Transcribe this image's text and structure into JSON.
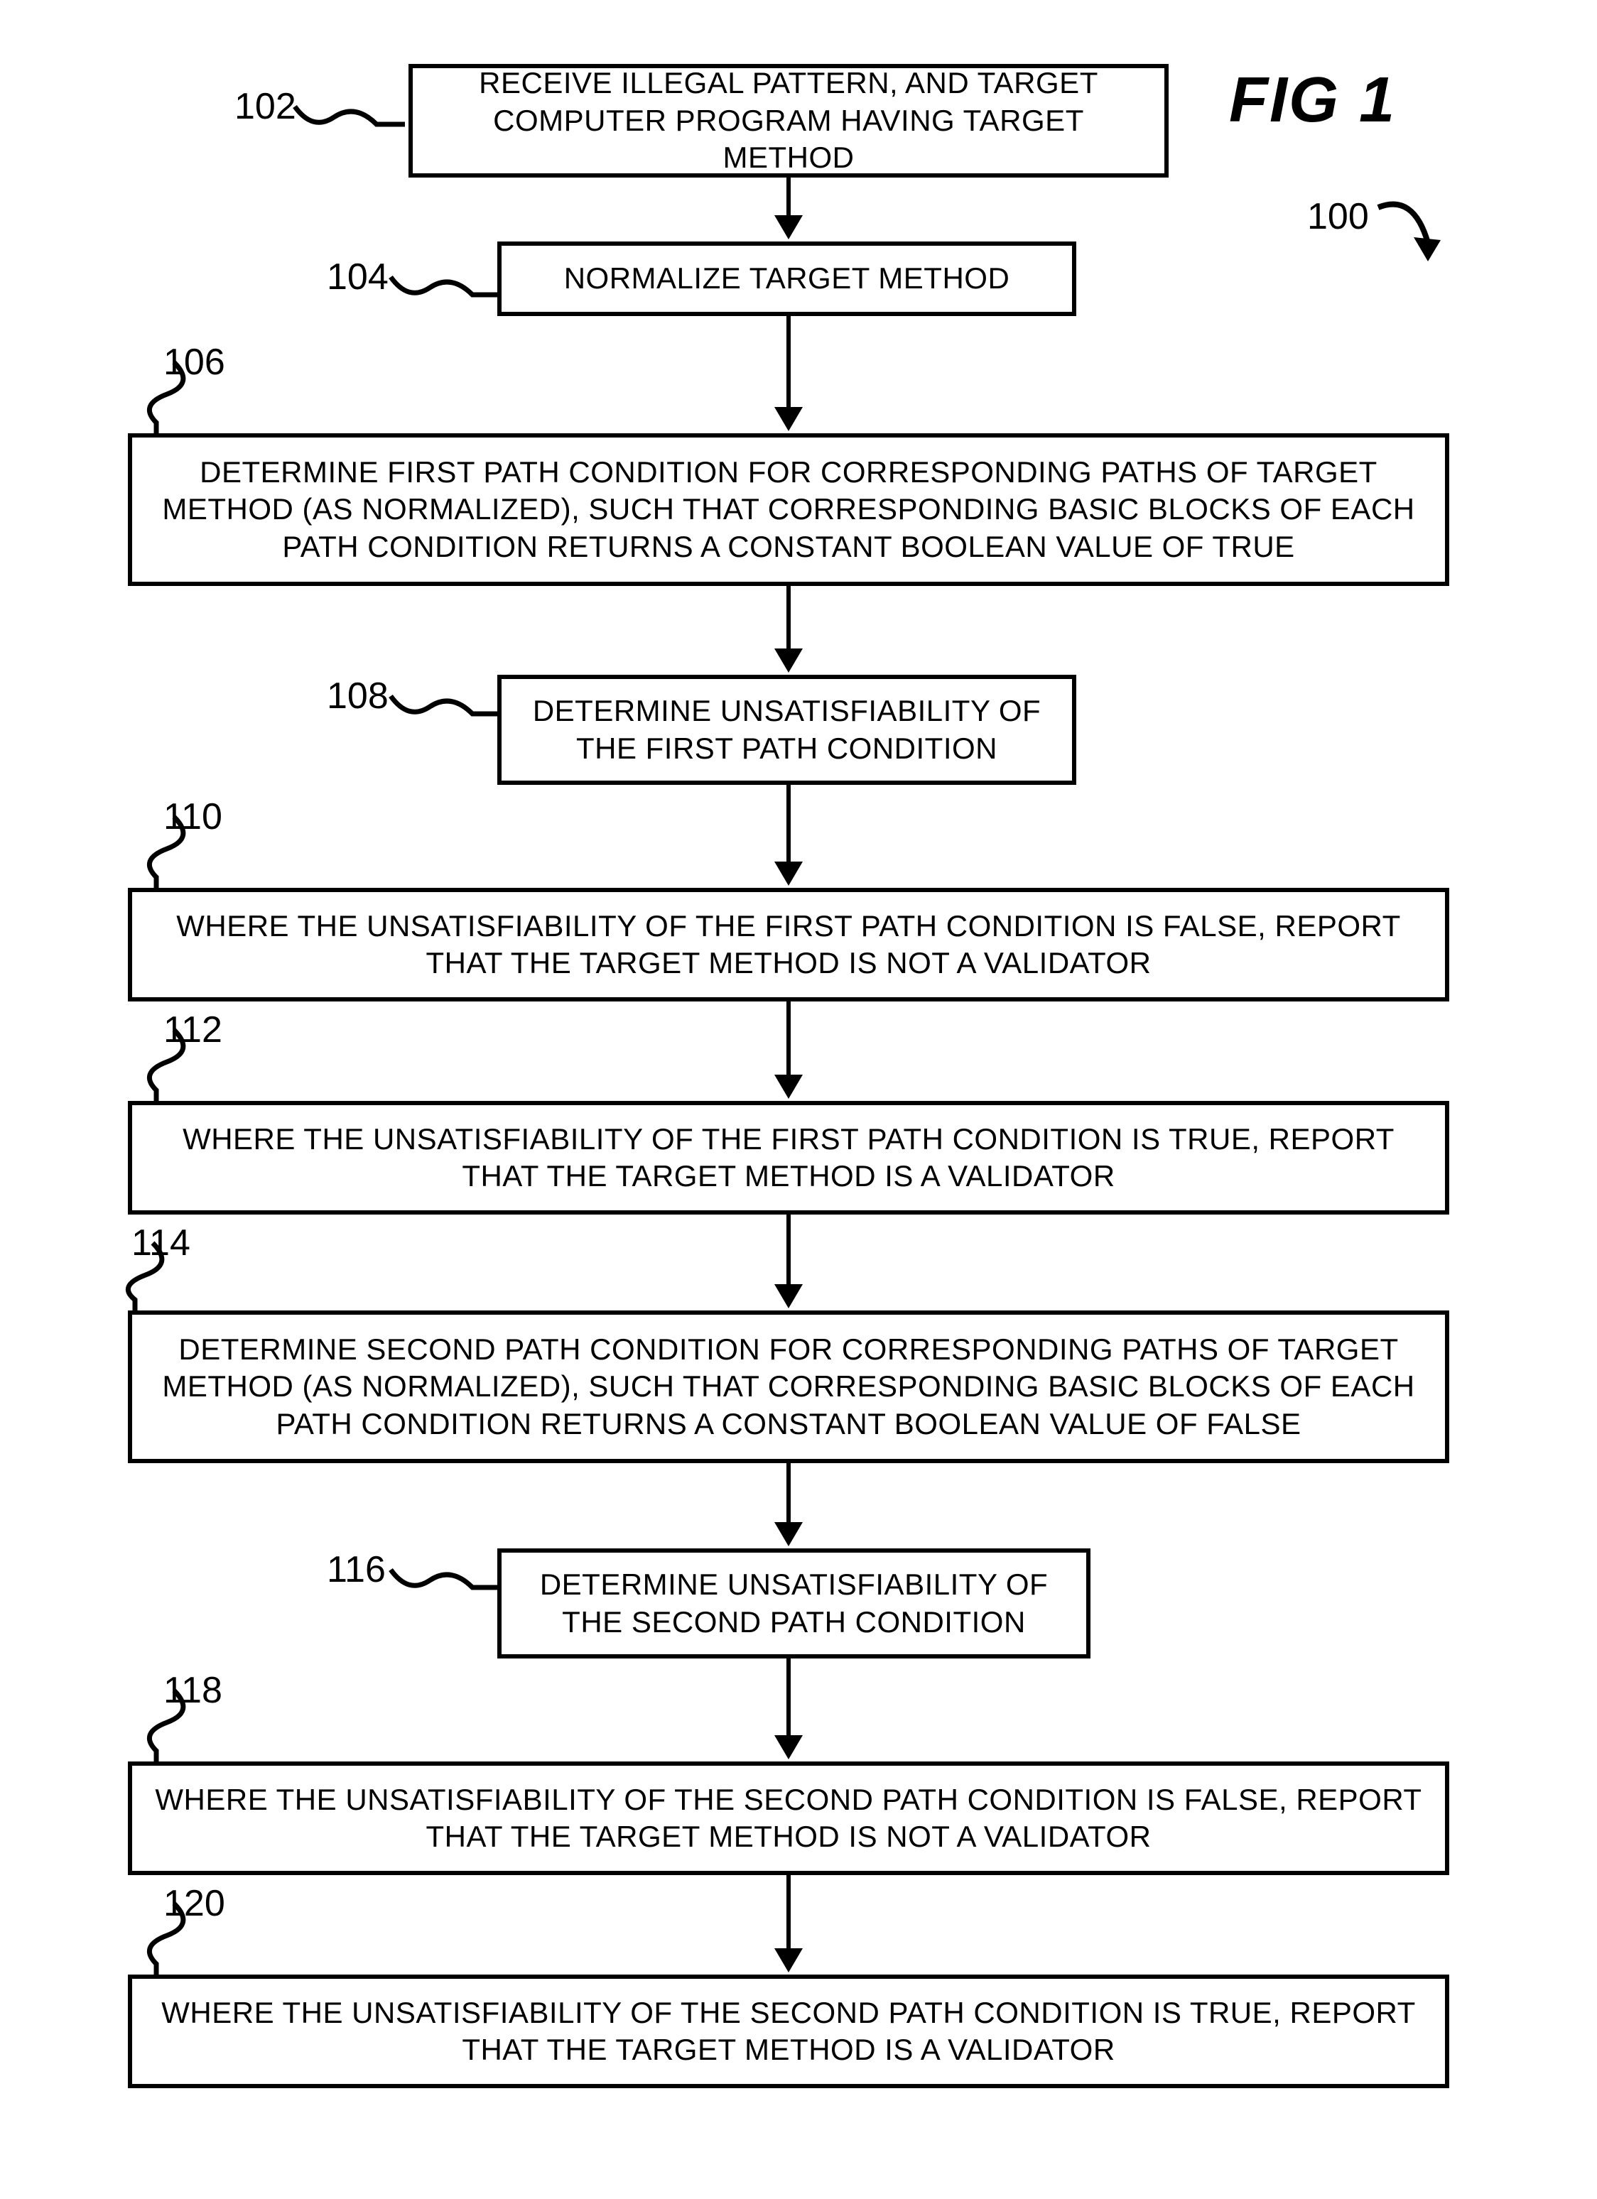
{
  "figure_label": "FIG 1",
  "ref_main": "100",
  "steps": [
    {
      "ref": "102",
      "text": "RECEIVE ILLEGAL PATTERN, AND TARGET COMPUTER PROGRAM HAVING TARGET METHOD"
    },
    {
      "ref": "104",
      "text": "NORMALIZE TARGET METHOD"
    },
    {
      "ref": "106",
      "text": "DETERMINE FIRST PATH CONDITION FOR CORRESPONDING PATHS OF TARGET METHOD (AS NORMALIZED), SUCH THAT CORRESPONDING BASIC BLOCKS OF EACH PATH CONDITION RETURNS A CONSTANT BOOLEAN VALUE OF TRUE"
    },
    {
      "ref": "108",
      "text": "DETERMINE UNSATISFIABILITY OF THE FIRST PATH CONDITION"
    },
    {
      "ref": "110",
      "text": "WHERE THE UNSATISFIABILITY OF THE FIRST PATH CONDITION IS FALSE, REPORT THAT THE TARGET METHOD IS NOT A VALIDATOR"
    },
    {
      "ref": "112",
      "text": "WHERE THE UNSATISFIABILITY OF THE FIRST PATH CONDITION IS TRUE, REPORT THAT THE TARGET METHOD IS A VALIDATOR"
    },
    {
      "ref": "114",
      "text": "DETERMINE SECOND PATH CONDITION FOR CORRESPONDING PATHS OF TARGET METHOD (AS NORMALIZED), SUCH THAT CORRESPONDING BASIC BLOCKS OF EACH PATH CONDITION RETURNS A CONSTANT BOOLEAN VALUE OF FALSE"
    },
    {
      "ref": "116",
      "text": "DETERMINE UNSATISFIABILITY OF THE SECOND PATH CONDITION"
    },
    {
      "ref": "118",
      "text": "WHERE THE UNSATISFIABILITY OF THE SECOND PATH CONDITION IS FALSE, REPORT THAT THE TARGET METHOD IS NOT A VALIDATOR"
    },
    {
      "ref": "120",
      "text": "WHERE THE UNSATISFIABILITY OF THE SECOND PATH CONDITION IS TRUE, REPORT THAT THE TARGET METHOD IS A VALIDATOR"
    }
  ]
}
